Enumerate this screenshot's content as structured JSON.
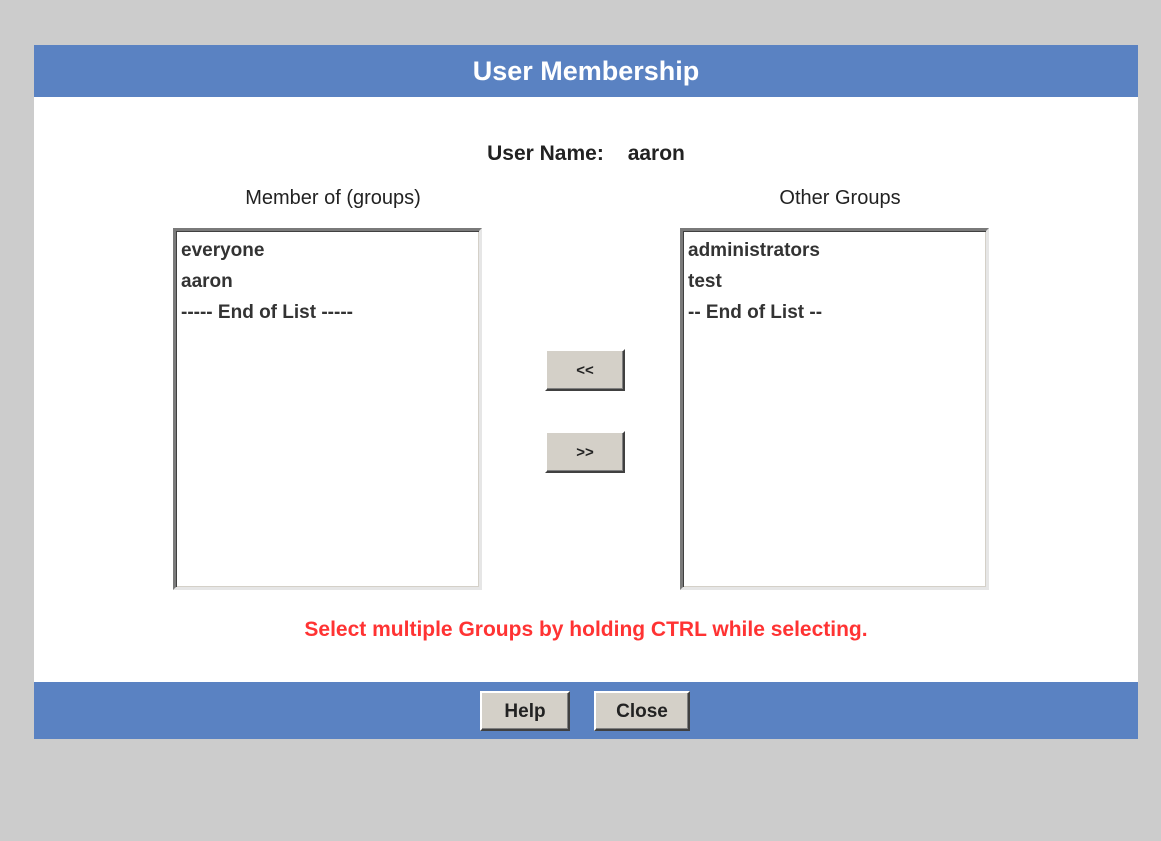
{
  "dialog": {
    "title": "User Membership"
  },
  "user": {
    "label": "User Name:",
    "value": "aaron"
  },
  "member_of": {
    "caption": "Member of (groups)",
    "items": [
      "everyone",
      "aaron",
      "----- End of List -----"
    ]
  },
  "other_groups": {
    "caption": "Other Groups",
    "items": [
      "administrators",
      "test",
      "-- End of List --"
    ]
  },
  "move_buttons": {
    "add_label": "<<",
    "remove_label": ">>"
  },
  "hint": "Select multiple Groups by holding CTRL while selecting.",
  "footer": {
    "help_label": "Help",
    "close_label": "Close"
  },
  "colors": {
    "background": "#cccccc",
    "bar": "#5a82c2",
    "hint": "#ff3333",
    "button_face": "#d4d0c8"
  }
}
